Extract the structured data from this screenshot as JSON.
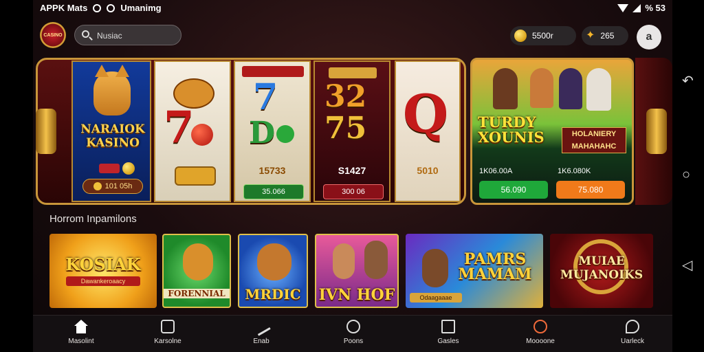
{
  "status_bar": {
    "left_text": "APPK Mats",
    "app_text": "Umanimg",
    "right_text": "% 53"
  },
  "header": {
    "logo_text": "CASINO",
    "search": {
      "value": "Nusiac",
      "placeholder": ""
    },
    "balance": "5500r",
    "points": "265",
    "profile_glyph": "a"
  },
  "reels": {
    "r1_title": "NARAIOK KASINO",
    "r1_value": "101 05h",
    "r2_sym": "7",
    "r3_sym_top": "7",
    "r3_sym_bottom": "D",
    "r3_mid": "15733",
    "r3_badge": "35.066",
    "r4_sym_top": "32",
    "r4_sym_bottom": "75",
    "r4_mid": "S1427",
    "r4_badge": "300 06",
    "r5_sym": "Q",
    "r5_mid": "5010"
  },
  "promo": {
    "title": "TURDY XOUNIS",
    "subtitle": "HOLANIERY MAHAHAHC",
    "label_left": "1K06.00A",
    "label_right": "1K6.080K",
    "btn_left": "56.090",
    "btn_right": "75.080"
  },
  "section": {
    "title": "Horrom Inpamilons"
  },
  "tiles": [
    {
      "label": "KOSIAK",
      "sublabel": "Dawankeroaacy"
    },
    {
      "label": "FORENNIAL"
    },
    {
      "label": "MRDIC"
    },
    {
      "label": "IVN HOF"
    },
    {
      "label": "PAMRS MAMAM",
      "sublabel": "Odaagaaae"
    },
    {
      "label": "MUIAE MUJANOIKS"
    }
  ],
  "bottom_nav": [
    {
      "label": "Masolint",
      "icon": "home-icon"
    },
    {
      "label": "Karsolne",
      "icon": "game-icon"
    },
    {
      "label": "Enab",
      "icon": "pen-icon"
    },
    {
      "label": "Poons",
      "icon": "clock-icon"
    },
    {
      "label": "Gasles",
      "icon": "screen-icon"
    },
    {
      "label": "Moooone",
      "icon": "search-icon"
    },
    {
      "label": "Uarleck",
      "icon": "chat-icon"
    }
  ],
  "system_nav": {
    "back": "↶",
    "home": "○",
    "recents": "◁"
  },
  "colors": {
    "accent_gold": "#c9963a",
    "green_button": "#1fa83a",
    "orange_button": "#f07a1a"
  }
}
